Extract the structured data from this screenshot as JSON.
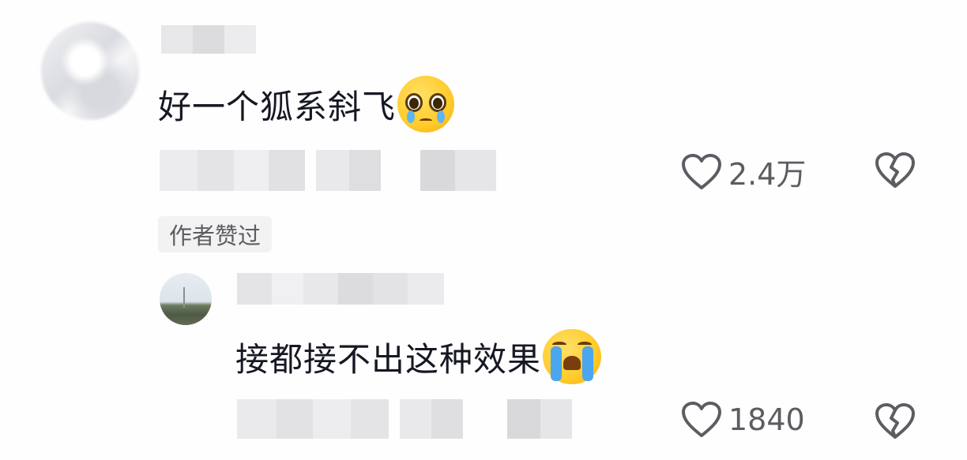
{
  "comments": [
    {
      "text": "好一个狐系斜飞",
      "emoji": "pleading-face-icon",
      "author_badge": "作者赞过",
      "likes": "2.4万"
    }
  ],
  "reply": {
    "text": "接都接不出这种效果",
    "emoji": "loudly-crying-face-icon",
    "likes": "1840"
  },
  "colors": {
    "text_primary": "#161823",
    "text_secondary": "#5c5d63",
    "badge_bg": "#f2f2f3",
    "background": "#fefefe"
  }
}
